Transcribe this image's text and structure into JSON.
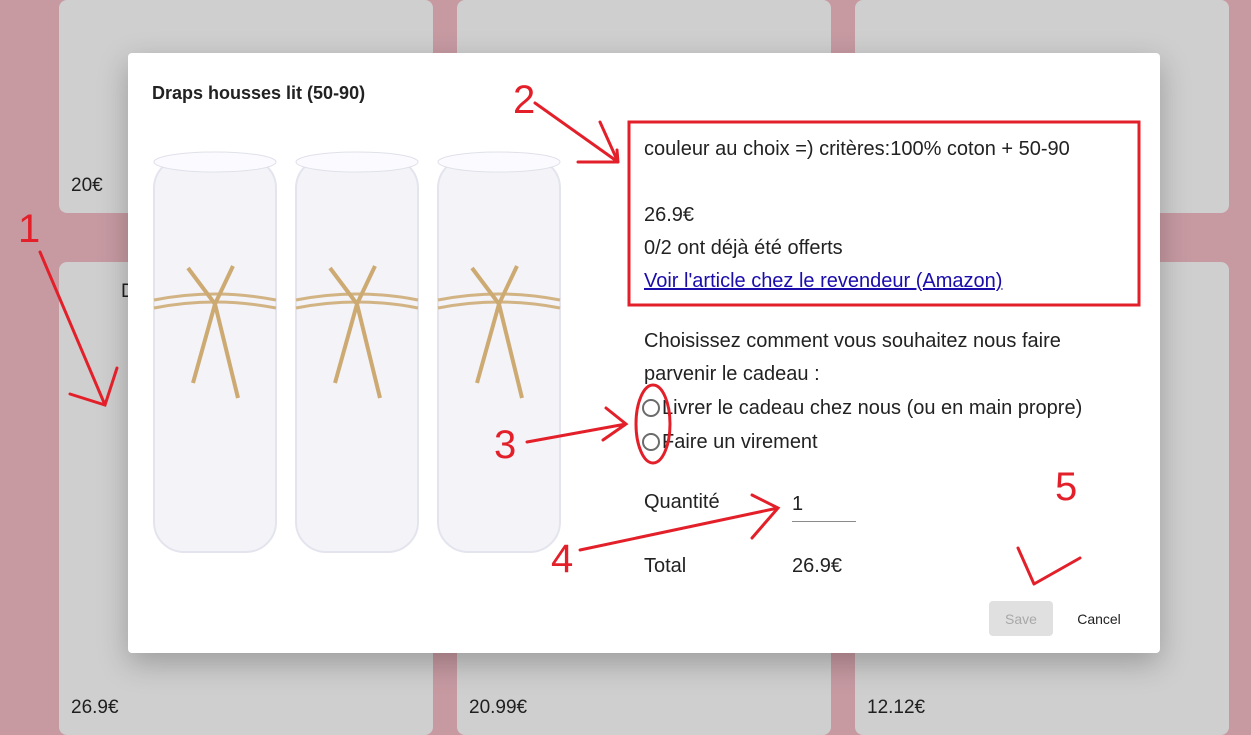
{
  "background": {
    "prices": [
      "20€",
      "26.9€",
      "20.99€",
      "12.12€"
    ],
    "partial_text": "D"
  },
  "dialog": {
    "title": "Draps housses lit (50-90)",
    "description": "couleur au choix =) critères:100% coton + 50-90",
    "price": "26.9€",
    "offered": "0/2 ont déjà été offerts",
    "link_text": "Voir l'article chez le revendeur (Amazon)",
    "choice_prompt": "Choisissez comment vous souhaitez nous faire parvenir le cadeau :",
    "options": [
      {
        "label": "Livrer le cadeau chez nous (ou en main propre)",
        "selected": false
      },
      {
        "label": "Faire un virement",
        "selected": false
      }
    ],
    "quantity_label": "Quantité",
    "quantity_value": "1",
    "total_label": "Total",
    "total_value": "26.9€",
    "save_label": "Save",
    "cancel_label": "Cancel"
  },
  "annotations": [
    "1",
    "2",
    "3",
    "4",
    "5"
  ],
  "colors": {
    "page_bg": "#c79aa2",
    "annotation": "#e3202a",
    "link": "#1a0dab"
  }
}
